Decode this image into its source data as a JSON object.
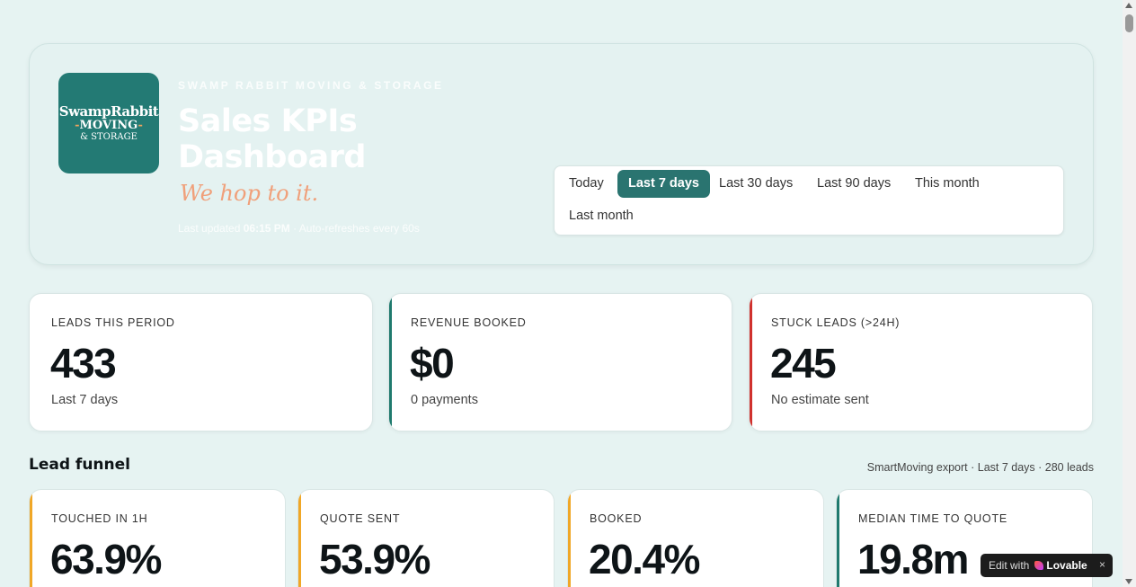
{
  "header": {
    "logo": {
      "line1": "SwampRabbit",
      "line2": "MOVING",
      "line3": "& STORAGE"
    },
    "company": "SWAMP RABBIT MOVING & STORAGE",
    "title": "Sales KPIs Dashboard",
    "tagline": "We hop to it.",
    "updated_prefix": "Last updated",
    "updated_time": "06:15 PM",
    "updated_suffix": "· Auto-refreshes every 60s"
  },
  "range": {
    "options": [
      "Today",
      "Last 7 days",
      "Last 30 days",
      "Last 90 days",
      "This month",
      "Last month"
    ],
    "selected": "Last 7 days"
  },
  "kpis": [
    {
      "label": "LEADS THIS PERIOD",
      "value": "433",
      "sub": "Last 7 days",
      "accent": ""
    },
    {
      "label": "REVENUE BOOKED",
      "value": "$0",
      "sub": "0 payments",
      "accent": "#1f7a6e"
    },
    {
      "label": "STUCK LEADS (>24H)",
      "value": "245",
      "sub": "No estimate sent",
      "accent": "#d0312d"
    }
  ],
  "funnel": {
    "title": "Lead funnel",
    "meta": "SmartMoving export · Last 7 days · 280 leads",
    "cards": [
      {
        "label": "TOUCHED IN 1H",
        "value": "63.9%",
        "accent": "#f0a727"
      },
      {
        "label": "QUOTE SENT",
        "value": "53.9%",
        "accent": "#f0a727"
      },
      {
        "label": "BOOKED",
        "value": "20.4%",
        "accent": "#f0a727"
      },
      {
        "label": "MEDIAN TIME TO QUOTE",
        "value": "19.8m",
        "accent": "#1f7a6e"
      }
    ]
  },
  "badge": {
    "edit": "Edit with",
    "brand": "Lovable",
    "close": "×"
  }
}
